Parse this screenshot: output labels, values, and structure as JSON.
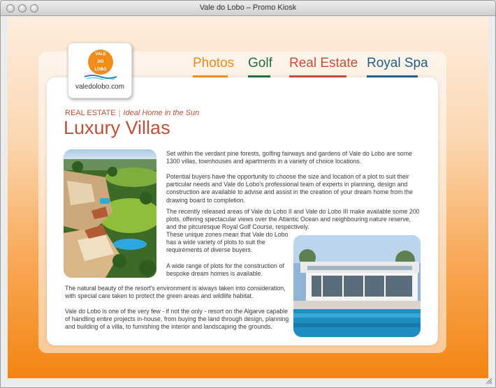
{
  "window": {
    "title": "Vale do Lobo – Promo Kiosk"
  },
  "logo": {
    "mark_lines": [
      "VALE",
      "DO",
      "LOBO"
    ],
    "url_text": "valedolobo.com"
  },
  "nav": [
    {
      "label": "Photos",
      "color": "#ef8a17"
    },
    {
      "label": "Golf",
      "color": "#1f6e3c"
    },
    {
      "label": "Real Estate",
      "color": "#c0503a"
    },
    {
      "label": "Royal Spa",
      "color": "#1f5f86"
    }
  ],
  "section": {
    "category": "REAL ESTATE",
    "separator": "|",
    "subtitle": "Ideal Home in the Sun",
    "title": "Luxury Villas"
  },
  "body": {
    "p1": "Set within the verdant pine forests, golfing fairways and gardens of Vale do Lobo are some 1300 villas, townhouses and apartments in a variety of choice locations.",
    "p2": "Potential buyers have the opportunity to choose the size and location of a plot to suit their particular needs and Vale do Lobo's professional team of experts in planning, design and construction are available to advise and assist in the creation of your dream home from the drawing board to completion.",
    "p3": "The recently released areas of Vale do Lobo II and Vale do Lobo III make available some 200 plots, offering spectacular views over the Atlantic Ocean and neighbouring nature reserve, and the pitcuresque Royal Golf Course, respectively.",
    "p4": "These unique zones mean that Vale do Lobo has a wide variety of plots to suit the requirements of diverse buyers.",
    "p5": "A wide range of plots for the construction of bespoke dream homes is available.",
    "p6": "The natural beauty of the resort's environment is always taken into consideration, with special care taken to protect the green areas and wildlife habitat.",
    "p7": "Vale do Lobo is one of the very few - if not the only - resort on the Algarve capable of handling entire projects in-house, from buying the land through design, planning and building of a villa, to furnishing the interior and landscaping the grounds."
  },
  "colors": {
    "accent": "#c0503a",
    "orange": "#f38511"
  }
}
